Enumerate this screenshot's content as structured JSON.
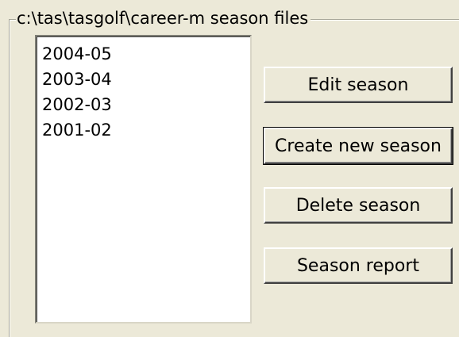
{
  "group": {
    "caption": "c:\\tas\\tasgolf\\career-m season files"
  },
  "season_list": {
    "items": [
      "2004-05",
      "2003-04",
      "2002-03",
      "2001-02"
    ]
  },
  "buttons": {
    "edit_label": "Edit season",
    "create_label": "Create new season",
    "delete_label": "Delete season",
    "report_label": "Season report"
  }
}
